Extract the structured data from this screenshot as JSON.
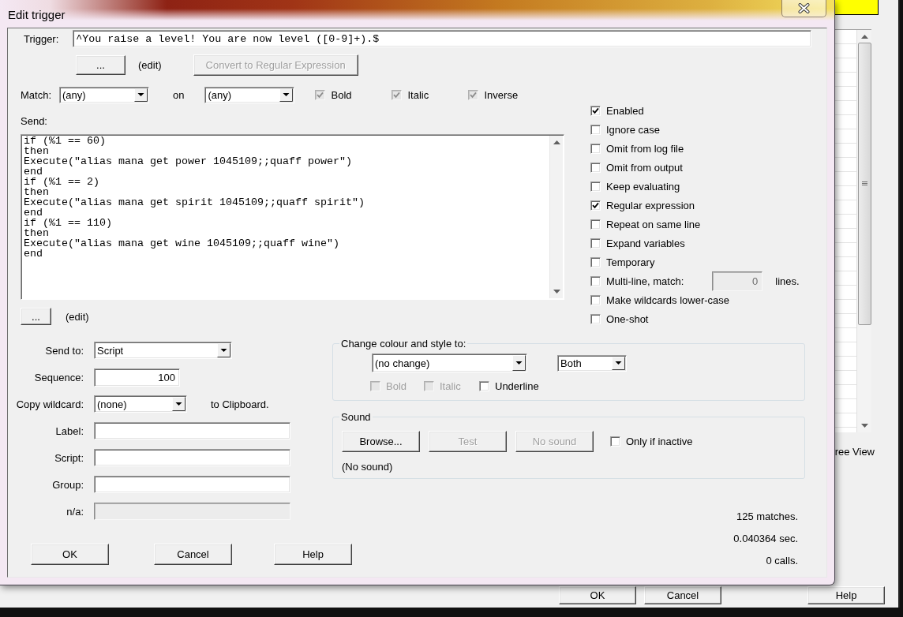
{
  "background_window": {
    "partial_label": "ree View",
    "buttons": [
      "OK",
      "Cancel",
      "Help"
    ]
  },
  "dialog": {
    "title": "Edit trigger",
    "trigger": {
      "label": "Trigger:",
      "value": "^You raise a level! You are now level ([0-9]+).$"
    },
    "trigger_edit": {
      "button": "...",
      "label": "(edit)"
    },
    "convert_button": {
      "label": "Convert to Regular Expression",
      "disabled": true
    },
    "match": {
      "label": "Match:",
      "value": "(any)",
      "on_label": "on",
      "on_value": "(any)",
      "styles": [
        {
          "label": "Bold",
          "indeterminate": true
        },
        {
          "label": "Italic",
          "indeterminate": true
        },
        {
          "label": "Inverse",
          "indeterminate": true
        }
      ]
    },
    "send": {
      "label": "Send:",
      "lines": [
        "if (%1 == 60)",
        "then",
        "Execute(\"alias mana get power 1045109;;quaff power\")",
        "end",
        "if (%1 == 2)",
        "then",
        "Execute(\"alias mana get spirit 1045109;;quaff spirit\")",
        "end",
        "if (%1 == 110)",
        "then",
        "Execute(\"alias mana get wine 1045109;;quaff wine\")",
        "end"
      ]
    },
    "send_edit": {
      "button": "...",
      "label": "(edit)"
    },
    "options": [
      {
        "kind": "check",
        "label": "Enabled",
        "checked": true
      },
      {
        "kind": "check",
        "label": "Ignore case",
        "checked": false
      },
      {
        "kind": "check",
        "label": "Omit from log file",
        "checked": false
      },
      {
        "kind": "check",
        "label": "Omit from output",
        "checked": false
      },
      {
        "kind": "check",
        "label": "Keep evaluating",
        "checked": false
      },
      {
        "kind": "check",
        "label": "Regular expression",
        "checked": true
      },
      {
        "kind": "check",
        "label": "Repeat on same line",
        "checked": false
      },
      {
        "kind": "check",
        "label": "Expand variables",
        "checked": false
      },
      {
        "kind": "check",
        "label": "Temporary",
        "checked": false
      },
      {
        "kind": "count",
        "label": "Multi-line, match:",
        "checked": false,
        "count": "0",
        "count_disabled": true,
        "unit": "lines."
      },
      {
        "kind": "check",
        "label": "Make wildcards lower-case",
        "checked": false
      },
      {
        "kind": "check",
        "label": "One-shot",
        "checked": false
      }
    ],
    "fields": [
      {
        "kind": "dropdown",
        "label": "Send to:",
        "value": "Script",
        "disabled": false
      },
      {
        "kind": "number",
        "label": "Sequence:",
        "value": "100",
        "disabled": false
      },
      {
        "kind": "dropdown",
        "label": "Copy wildcard:",
        "value": "(none)",
        "suffix": "to Clipboard.",
        "disabled": false
      },
      {
        "kind": "text",
        "label": "Label:",
        "disabled": false
      },
      {
        "kind": "text",
        "label": "Script:",
        "disabled": false
      },
      {
        "kind": "text",
        "label": "Group:",
        "disabled": false
      },
      {
        "kind": "text",
        "label": "n/a:",
        "disabled": true
      }
    ],
    "buttons": [
      "OK",
      "Cancel",
      "Help"
    ],
    "colour_group": {
      "title": "Change colour and style to:",
      "colour": "(no change)",
      "apply_to": "Both",
      "styles": [
        {
          "label": "Bold",
          "checked": false,
          "disabled": true
        },
        {
          "label": "Italic",
          "checked": false,
          "disabled": true
        },
        {
          "label": "Underline",
          "checked": false,
          "disabled": false
        }
      ]
    },
    "sound_group": {
      "title": "Sound",
      "buttons": [
        {
          "label": "Browse...",
          "disabled": false
        },
        {
          "label": "Test",
          "disabled": true
        },
        {
          "label": "No sound",
          "disabled": true
        }
      ],
      "only_if_inactive": {
        "label": "Only if inactive",
        "checked": false
      },
      "file": "(No sound)"
    },
    "stats": [
      "125 matches.",
      "0.040364 sec.",
      "0 calls."
    ]
  }
}
